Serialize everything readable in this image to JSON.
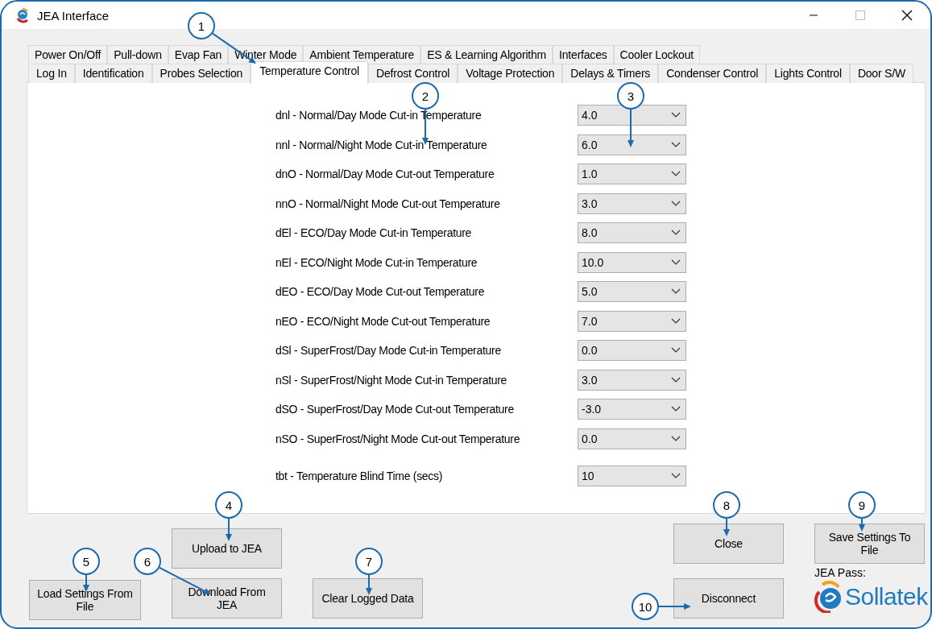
{
  "window": {
    "title": "JEA Interface"
  },
  "tab_rows": [
    [
      {
        "label": "Power On/Off",
        "selected": false
      },
      {
        "label": "Pull-down",
        "selected": false
      },
      {
        "label": "Evap Fan",
        "selected": false
      },
      {
        "label": "Winter Mode",
        "selected": false
      },
      {
        "label": "Ambient Temperature",
        "selected": false
      },
      {
        "label": "ES & Learning Algorithm",
        "selected": false
      },
      {
        "label": "Interfaces",
        "selected": false
      },
      {
        "label": "Cooler Lockout",
        "selected": false
      }
    ],
    [
      {
        "label": "Log In",
        "selected": false
      },
      {
        "label": "Identification",
        "selected": false
      },
      {
        "label": "Probes Selection",
        "selected": false
      },
      {
        "label": "Temperature Control",
        "selected": true
      },
      {
        "label": "Defrost Control",
        "selected": false
      },
      {
        "label": "Voltage Protection",
        "selected": false
      },
      {
        "label": "Delays & Timers",
        "selected": false
      },
      {
        "label": "Condenser Control",
        "selected": false
      },
      {
        "label": "Lights Control",
        "selected": false
      },
      {
        "label": "Door S/W",
        "selected": false
      }
    ]
  ],
  "settings": [
    {
      "label": "dnl - Normal/Day Mode Cut-in Temperature",
      "value": "4.0"
    },
    {
      "label": "nnl - Normal/Night Mode Cut-in Temperature",
      "value": "6.0"
    },
    {
      "label": "dnO - Normal/Day Mode Cut-out Temperature",
      "value": "1.0"
    },
    {
      "label": "nnO - Normal/Night Mode Cut-out Temperature",
      "value": "3.0"
    },
    {
      "label": "dEl - ECO/Day Mode Cut-in Temperature",
      "value": "8.0"
    },
    {
      "label": "nEl - ECO/Night Mode Cut-in Temperature",
      "value": "10.0"
    },
    {
      "label": "dEO - ECO/Day Mode Cut-out Temperature",
      "value": "5.0"
    },
    {
      "label": "nEO - ECO/Night Mode Cut-out Temperature",
      "value": "7.0"
    },
    {
      "label": "dSl - SuperFrost/Day Mode Cut-in Temperature",
      "value": "0.0"
    },
    {
      "label": "nSl - SuperFrost/Night Mode Cut-in Temperature",
      "value": "3.0"
    },
    {
      "label": "dSO - SuperFrost/Day Mode Cut-out Temperature",
      "value": "-3.0"
    },
    {
      "label": "nSO - SuperFrost/Night Mode Cut-out Temperature",
      "value": "0.0"
    },
    {
      "label": "tbt - Temperature Blind Time (secs)",
      "value": "10"
    }
  ],
  "buttons": {
    "upload": "Upload to JEA",
    "load": "Load Settings From File",
    "download": "Download From JEA",
    "clear": "Clear Logged Data",
    "close": "Close",
    "save": "Save Settings To File",
    "disconnect": "Disconnect"
  },
  "pass_label": "JEA Pass:",
  "logo_text": "Sollatek",
  "callouts": [
    "1",
    "2",
    "3",
    "4",
    "5",
    "6",
    "7",
    "8",
    "9",
    "10"
  ]
}
